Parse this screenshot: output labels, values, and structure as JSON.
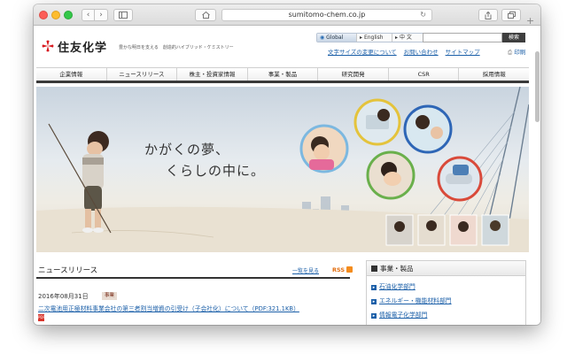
{
  "browser": {
    "url": "sumitomo-chem.co.jp",
    "icons": [
      "back-icon",
      "forward-icon",
      "sidebar-icon",
      "home-icon",
      "reload-icon",
      "share-icon",
      "tabs-icon",
      "plus-icon"
    ]
  },
  "header": {
    "logo_text": "住友化学",
    "tagline": "豊かな明日を支える　創造的ハイブリッド・ケミストリー",
    "lang": {
      "global": "Global",
      "english": "English",
      "chinese": "中 文"
    },
    "search_button": "検索",
    "util_links": [
      "文字サイズの変更について",
      "お問い合わせ",
      "サイトマップ"
    ],
    "print": "印刷"
  },
  "nav": [
    "企業情報",
    "ニュースリリース",
    "株主・投資家情報",
    "事業・製品",
    "研究開発",
    "CSR",
    "採用情報"
  ],
  "hero": {
    "line1": "かがくの夢、",
    "line2": "くらしの中に。"
  },
  "news": {
    "title": "ニュースリリース",
    "more": "一覧を見る",
    "rss": "RSS",
    "items": [
      {
        "date": "2016年08月31日",
        "category": "事業",
        "title": "二次電池用正極材料事業会社の第三者割当増資の引受け（子会社化）について（PDF:321.1KB）",
        "pdf_label": "PDF"
      }
    ]
  },
  "products": {
    "title": "事業・製品",
    "items": [
      "石油化学部門",
      "エネルギー・機能材料部門",
      "情報電子化学部門"
    ]
  },
  "colors": {
    "link": "#1b5fa8",
    "logo_red": "#d7191f",
    "nav_rule": "#3a3a3a"
  }
}
